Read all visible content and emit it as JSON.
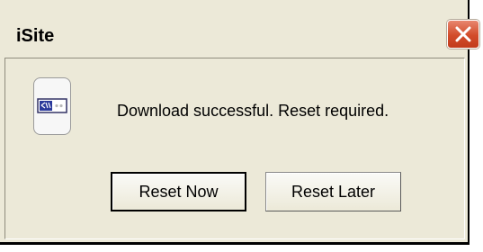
{
  "window": {
    "title": "iSite",
    "close_icon": "close-icon"
  },
  "message": {
    "text": "Download successful. Reset required.",
    "icon": "device-icon"
  },
  "buttons": {
    "reset_now": "Reset Now",
    "reset_later": "Reset Later"
  },
  "colors": {
    "dialog_background": "#ece9d8",
    "close_button": "#d24c2a"
  }
}
